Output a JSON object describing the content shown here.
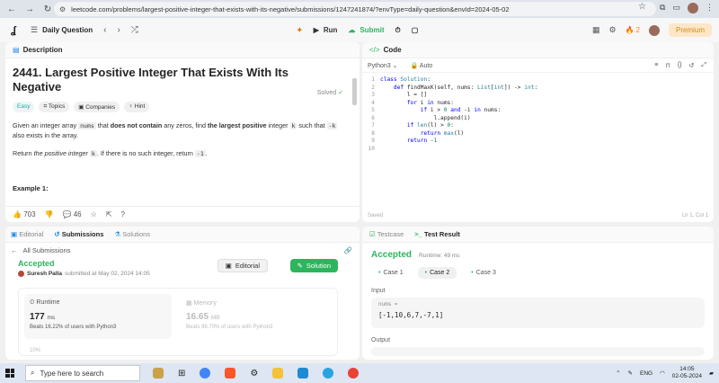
{
  "browser": {
    "url": "leetcode.com/problems/largest-positive-integer-that-exists-with-its-negative/submissions/1247241874/?envType=daily-question&envId=2024-05-02"
  },
  "topbar": {
    "daily_question": "Daily Question",
    "run": "Run",
    "submit": "Submit",
    "streak": "2",
    "premium": "Premium"
  },
  "description": {
    "tab": "Description",
    "title": "2441. Largest Positive Integer That Exists With Its Negative",
    "solved": "Solved",
    "chips": [
      "Easy",
      "Topics",
      "Companies",
      "Hint"
    ],
    "para1": {
      "a": "Given an integer array ",
      "b": "nums",
      "c": " that ",
      "d": "does not contain",
      "e": " any zeros, find ",
      "f": "the largest positive",
      "g": " integer ",
      "h": "k",
      "i": " such that ",
      "j": "-k",
      "k": " also exists in the array."
    },
    "para2": {
      "a": "Return ",
      "b": "the positive integer",
      "c": " ",
      "d": "k",
      "e": ". If there is no such integer, return ",
      "f": "-1",
      "g": "."
    },
    "example": "Example 1:",
    "likes": "703",
    "comments": "46"
  },
  "code": {
    "tab": "Code",
    "language": "Python3",
    "auto": "Auto",
    "saved": "Saved",
    "cursor": "Ln 1, Col 1",
    "lines": [
      "class Solution:",
      "    def findMaxK(self, nums: List[int]) -> int:",
      "        l = []",
      "        for i in nums:",
      "            if i > 0 and -i in nums:",
      "                l.append(i)",
      "        if len(l) > 0:",
      "            return max(l)",
      "        return -1",
      ""
    ]
  },
  "submissions": {
    "tabs": [
      "Editorial",
      "Submissions",
      "Solutions"
    ],
    "all": "All Submissions",
    "status": "Accepted",
    "user": "Suresh Palla",
    "submitted": "submitted at May 02, 2024 14:05",
    "editorial_btn": "Editorial",
    "solution_btn": "Solution",
    "runtime_label": "Runtime",
    "runtime_value": "177",
    "runtime_unit": "ms",
    "runtime_beats": "Beats 16.22% of users with Python3",
    "memory_label": "Memory",
    "memory_value": "16.65",
    "memory_unit": "MB",
    "memory_beats": "Beats 98.70% of users with Python3",
    "pct": "10%"
  },
  "tests": {
    "testcase_tab": "Testcase",
    "result_tab": "Test Result",
    "status": "Accepted",
    "runtime": "Runtime: 49 ms",
    "cases": [
      "Case 1",
      "Case 2",
      "Case 3"
    ],
    "input_label": "Input",
    "var": "nums =",
    "value": "[-1,10,6,7,-7,1]",
    "output_label": "Output"
  },
  "taskbar": {
    "search": "Type here to search",
    "lang": "ENG",
    "time": "14:05",
    "date": "02-05-2024"
  }
}
